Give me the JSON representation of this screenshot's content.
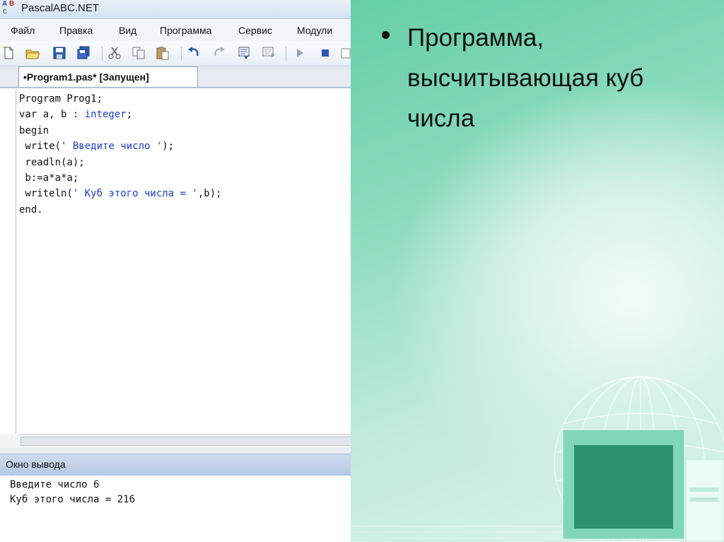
{
  "app": {
    "title": "PascalABC.NET",
    "logo": {
      "letters": [
        "A",
        "B",
        "C"
      ],
      "colors": [
        "#2244aa",
        "#c62828",
        "#2e7d32"
      ]
    }
  },
  "menu": [
    "Файл",
    "Правка",
    "Вид",
    "Программа",
    "Сервис",
    "Модули"
  ],
  "toolbar": {
    "icons": [
      "new-file-icon",
      "open-folder-icon",
      "save-icon",
      "save-all-icon",
      "cut-icon",
      "copy-icon",
      "paste-icon",
      "undo-icon",
      "redo-icon",
      "find-icon",
      "replace-icon",
      "run-icon",
      "stop-icon",
      "more-icon"
    ]
  },
  "tab": {
    "label": "•Program1.pas* [Запущен]"
  },
  "code": [
    [
      {
        "t": "Program Prog1;",
        "c": "kw"
      }
    ],
    [
      {
        "t": "var a, b : ",
        "c": "kw"
      },
      {
        "t": "integer",
        "c": "ty"
      },
      {
        "t": ";",
        "c": "kw"
      }
    ],
    [
      {
        "t": "begin",
        "c": "kw"
      }
    ],
    [
      {
        "t": " write(",
        "c": "kw"
      },
      {
        "t": "' Введите число '",
        "c": "st"
      },
      {
        "t": ");",
        "c": "kw"
      }
    ],
    [
      {
        "t": " readln(a);",
        "c": "kw"
      }
    ],
    [
      {
        "t": " b:=a*a*a;",
        "c": "kw"
      }
    ],
    [
      {
        "t": " writeln(",
        "c": "kw"
      },
      {
        "t": "' Куб этого числа = '",
        "c": "st"
      },
      {
        "t": ",b);",
        "c": "kw"
      }
    ],
    [
      {
        "t": "end.",
        "c": "kw"
      }
    ]
  ],
  "output": {
    "title": "Окно вывода",
    "lines": [
      "Введите число 6",
      "Куб этого числа = 216"
    ]
  },
  "slide": {
    "bullet": "Программа, высчитывающая куб числа"
  }
}
